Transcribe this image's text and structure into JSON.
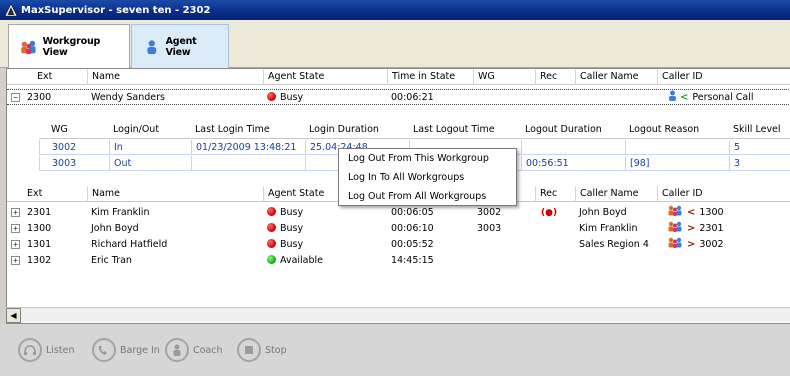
{
  "window": {
    "title": "MaxSupervisor - seven ten - 2302"
  },
  "tabs": [
    {
      "label": "Workgroup View",
      "icon": "workgroup-people-icon"
    },
    {
      "label": "Agent View",
      "icon": "agent-person-icon"
    }
  ],
  "agent_grid": {
    "columns": [
      "Ext",
      "Name",
      "Agent State",
      "Time in State",
      "WG",
      "Rec",
      "Caller Name",
      "Caller ID"
    ],
    "expanded_row": {
      "ext": "2300",
      "name": "Wendy Sanders",
      "state": "Busy",
      "time": "00:06:21",
      "wg": "",
      "rec": "",
      "caller_name": "",
      "caller_id": "Personal Call",
      "expander": "−"
    },
    "rows": [
      {
        "ext": "2301",
        "name": "Kim Franklin",
        "state": "Busy",
        "state_color": "red",
        "time": "00:06:05",
        "wg": "3002",
        "rec": "(●)",
        "caller_name": "John Boyd",
        "caller_id": "1300",
        "expander": "+"
      },
      {
        "ext": "1300",
        "name": "John Boyd",
        "state": "Busy",
        "state_color": "red",
        "time": "00:06:10",
        "wg": "3003",
        "rec": "",
        "caller_name": "Kim Franklin",
        "caller_id": "2301",
        "expander": "+"
      },
      {
        "ext": "1301",
        "name": "Richard Hatfield",
        "state": "Busy",
        "state_color": "red",
        "time": "00:05:52",
        "wg": "",
        "rec": "",
        "caller_name": "Sales Region 4",
        "caller_id": "3002",
        "expander": "+"
      },
      {
        "ext": "1302",
        "name": "Eric Tran",
        "state": "Available",
        "state_color": "green",
        "time": "14:45:15",
        "wg": "",
        "rec": "",
        "caller_name": "",
        "caller_id": "",
        "expander": "+"
      }
    ]
  },
  "workgroup_subgrid": {
    "columns": [
      "WG",
      "Login/Out",
      "Last Login Time",
      "Login Duration",
      "Last Logout Time",
      "Logout Duration",
      "Logout Reason",
      "Skill Level"
    ],
    "rows": [
      {
        "wg": "3002",
        "login": "In",
        "last_login": "01/23/2009 13:48:21",
        "login_duration": "25.04:24:48",
        "last_logout": "",
        "logout_duration": "",
        "logout_reason": "",
        "skill": "5"
      },
      {
        "wg": "3003",
        "login": "Out",
        "last_login": "",
        "login_duration": "",
        "last_logout": "",
        "logout_duration": "00:56:51",
        "logout_reason": "[98]",
        "skill": "3"
      }
    ]
  },
  "context_menu": {
    "items": [
      "Log Out From This Workgroup",
      "Log In To All Workgroups",
      "Log Out From All Workgroups"
    ]
  },
  "controls": [
    "Listen",
    "Barge In",
    "Coach",
    "Stop"
  ],
  "colors": {
    "title_bar": "#0a2c8a",
    "busy": "#c00000",
    "available": "#12a012",
    "subgrid_text": "#1b3fa0"
  }
}
